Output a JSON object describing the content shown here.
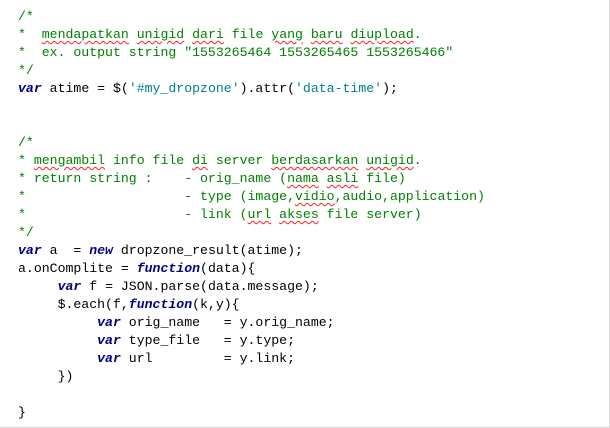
{
  "colors": {
    "comment": "#008000",
    "string": "#008080",
    "keyword": "#000080",
    "plain": "#000000",
    "spellcheck_underline": "#ff2020",
    "background": "#ffffff"
  },
  "code_lines": [
    {
      "tokens": [
        {
          "t": "comment",
          "v": "/*"
        }
      ]
    },
    {
      "tokens": [
        {
          "t": "comment",
          "v": "*  "
        },
        {
          "t": "comment",
          "v": "mendapatkan",
          "spell": true
        },
        {
          "t": "comment",
          "v": " "
        },
        {
          "t": "comment",
          "v": "unigid",
          "spell": true
        },
        {
          "t": "comment",
          "v": " "
        },
        {
          "t": "comment",
          "v": "dari",
          "spell": true
        },
        {
          "t": "comment",
          "v": " file "
        },
        {
          "t": "comment",
          "v": "yang",
          "spell": true
        },
        {
          "t": "comment",
          "v": " "
        },
        {
          "t": "comment",
          "v": "baru",
          "spell": true
        },
        {
          "t": "comment",
          "v": " "
        },
        {
          "t": "comment",
          "v": "diupload",
          "spell": true
        },
        {
          "t": "comment",
          "v": "."
        }
      ]
    },
    {
      "tokens": [
        {
          "t": "comment",
          "v": "*  ex. output string \"1553265464 1553265465 1553265466\""
        }
      ]
    },
    {
      "tokens": [
        {
          "t": "comment",
          "v": "*/"
        }
      ]
    },
    {
      "tokens": [
        {
          "t": "keyword",
          "v": "var"
        },
        {
          "t": "plain",
          "v": " atime = $("
        },
        {
          "t": "string",
          "v": "'#my_dropzone'"
        },
        {
          "t": "plain",
          "v": ").attr("
        },
        {
          "t": "string",
          "v": "'data-time'"
        },
        {
          "t": "plain",
          "v": ");"
        }
      ]
    },
    {
      "tokens": []
    },
    {
      "tokens": []
    },
    {
      "tokens": [
        {
          "t": "comment",
          "v": "/*"
        }
      ]
    },
    {
      "tokens": [
        {
          "t": "comment",
          "v": "* "
        },
        {
          "t": "comment",
          "v": "mengambil",
          "spell": true
        },
        {
          "t": "comment",
          "v": " info file "
        },
        {
          "t": "comment",
          "v": "di",
          "spell": true
        },
        {
          "t": "comment",
          "v": " server "
        },
        {
          "t": "comment",
          "v": "berdasarkan",
          "spell": true
        },
        {
          "t": "comment",
          "v": " "
        },
        {
          "t": "comment",
          "v": "unigid",
          "spell": true
        },
        {
          "t": "comment",
          "v": "."
        }
      ]
    },
    {
      "tokens": [
        {
          "t": "comment",
          "v": "* return string :    - orig_name ("
        },
        {
          "t": "comment",
          "v": "nama",
          "spell": true
        },
        {
          "t": "comment",
          "v": " "
        },
        {
          "t": "comment",
          "v": "asli",
          "spell": true
        },
        {
          "t": "comment",
          "v": " file)"
        }
      ]
    },
    {
      "tokens": [
        {
          "t": "comment",
          "v": "*                    - type (image,"
        },
        {
          "t": "comment",
          "v": "vidio",
          "spell": true
        },
        {
          "t": "comment",
          "v": ",audio,application)"
        }
      ]
    },
    {
      "tokens": [
        {
          "t": "comment",
          "v": "*                    - link ("
        },
        {
          "t": "comment",
          "v": "url",
          "spell": true
        },
        {
          "t": "comment",
          "v": " "
        },
        {
          "t": "comment",
          "v": "akses",
          "spell": true
        },
        {
          "t": "comment",
          "v": " file server)"
        }
      ]
    },
    {
      "tokens": [
        {
          "t": "comment",
          "v": "*/"
        }
      ]
    },
    {
      "tokens": [
        {
          "t": "keyword",
          "v": "var"
        },
        {
          "t": "plain",
          "v": " a  = "
        },
        {
          "t": "keyword",
          "v": "new"
        },
        {
          "t": "plain",
          "v": " dropzone_result(atime);"
        }
      ]
    },
    {
      "tokens": [
        {
          "t": "plain",
          "v": "a.onComplite = "
        },
        {
          "t": "keyword",
          "v": "function"
        },
        {
          "t": "plain",
          "v": "(data){"
        }
      ]
    },
    {
      "tokens": [
        {
          "t": "plain",
          "v": "     "
        },
        {
          "t": "keyword",
          "v": "var"
        },
        {
          "t": "plain",
          "v": " f = JSON.parse(data.message);"
        }
      ]
    },
    {
      "tokens": [
        {
          "t": "plain",
          "v": "     $.each(f,"
        },
        {
          "t": "keyword",
          "v": "function"
        },
        {
          "t": "plain",
          "v": "(k,y){"
        }
      ]
    },
    {
      "tokens": [
        {
          "t": "plain",
          "v": "          "
        },
        {
          "t": "keyword",
          "v": "var"
        },
        {
          "t": "plain",
          "v": " orig_name   = y.orig_name;"
        }
      ]
    },
    {
      "tokens": [
        {
          "t": "plain",
          "v": "          "
        },
        {
          "t": "keyword",
          "v": "var"
        },
        {
          "t": "plain",
          "v": " type_file   = y.type;"
        }
      ]
    },
    {
      "tokens": [
        {
          "t": "plain",
          "v": "          "
        },
        {
          "t": "keyword",
          "v": "var"
        },
        {
          "t": "plain",
          "v": " url         = y.link;"
        }
      ]
    },
    {
      "tokens": [
        {
          "t": "plain",
          "v": "     })"
        }
      ]
    },
    {
      "tokens": []
    },
    {
      "tokens": [
        {
          "t": "plain",
          "v": "}"
        }
      ]
    }
  ]
}
